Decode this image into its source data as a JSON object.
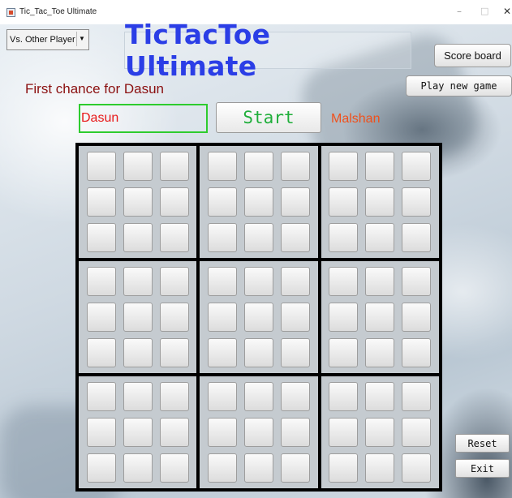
{
  "window": {
    "title": "Tic_Tac_Toe Ultimate",
    "minimize": "–",
    "maximize": "□",
    "close": "✕"
  },
  "controls": {
    "mode_selected": "Vs. Other Player",
    "mode_arrow": "▼",
    "game_title": "TicTacToe Ultimate",
    "score_board": "Score board",
    "play_new_game": "Play new game",
    "chance_message": "First chance for Dasun",
    "player1_value": "Dasun",
    "start": "Start",
    "player2_label": "Malshan",
    "reset": "Reset",
    "exit": "Exit"
  },
  "colors": {
    "title": "#2b3ee6",
    "chance_text": "#8b1010",
    "player1": "#e81818",
    "player2": "#f0501b",
    "start": "#1fae3a",
    "field_border": "#2ecc2e"
  },
  "board": {
    "sub_boards": 9,
    "cells_per_sub_board": 9,
    "cells": [
      [
        "",
        "",
        "",
        "",
        "",
        "",
        "",
        "",
        ""
      ],
      [
        "",
        "",
        "",
        "",
        "",
        "",
        "",
        "",
        ""
      ],
      [
        "",
        "",
        "",
        "",
        "",
        "",
        "",
        "",
        ""
      ],
      [
        "",
        "",
        "",
        "",
        "",
        "",
        "",
        "",
        ""
      ],
      [
        "",
        "",
        "",
        "",
        "",
        "",
        "",
        "",
        ""
      ],
      [
        "",
        "",
        "",
        "",
        "",
        "",
        "",
        "",
        ""
      ],
      [
        "",
        "",
        "",
        "",
        "",
        "",
        "",
        "",
        ""
      ],
      [
        "",
        "",
        "",
        "",
        "",
        "",
        "",
        "",
        ""
      ],
      [
        "",
        "",
        "",
        "",
        "",
        "",
        "",
        "",
        ""
      ]
    ]
  }
}
